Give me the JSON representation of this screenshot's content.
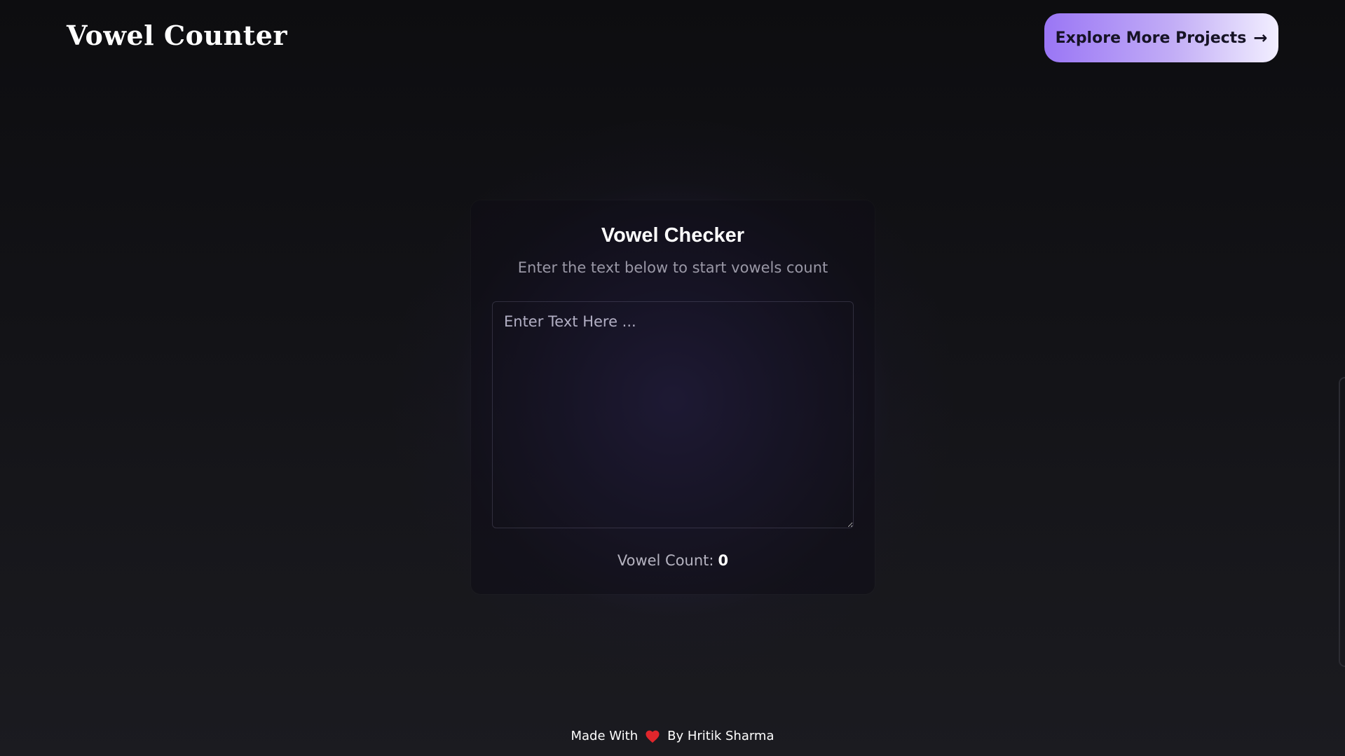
{
  "header": {
    "title": "Vowel Counter",
    "explore_button_label": "Explore More  Projects",
    "explore_button_icon": "arrow-right-icon"
  },
  "card": {
    "title": "Vowel Checker",
    "subtitle": "Enter the text below to start vowels count",
    "input": {
      "value": "",
      "placeholder": "Enter Text Here ..."
    },
    "count_label": "Vowel Count:",
    "count_value": "0"
  },
  "footer": {
    "made_with": "Made With",
    "heart_icon": "heart-icon",
    "by_author": "By Hritik Sharma"
  },
  "colors": {
    "background": "#131317",
    "accent": "#9a76f5",
    "heart": "#e0262c"
  }
}
